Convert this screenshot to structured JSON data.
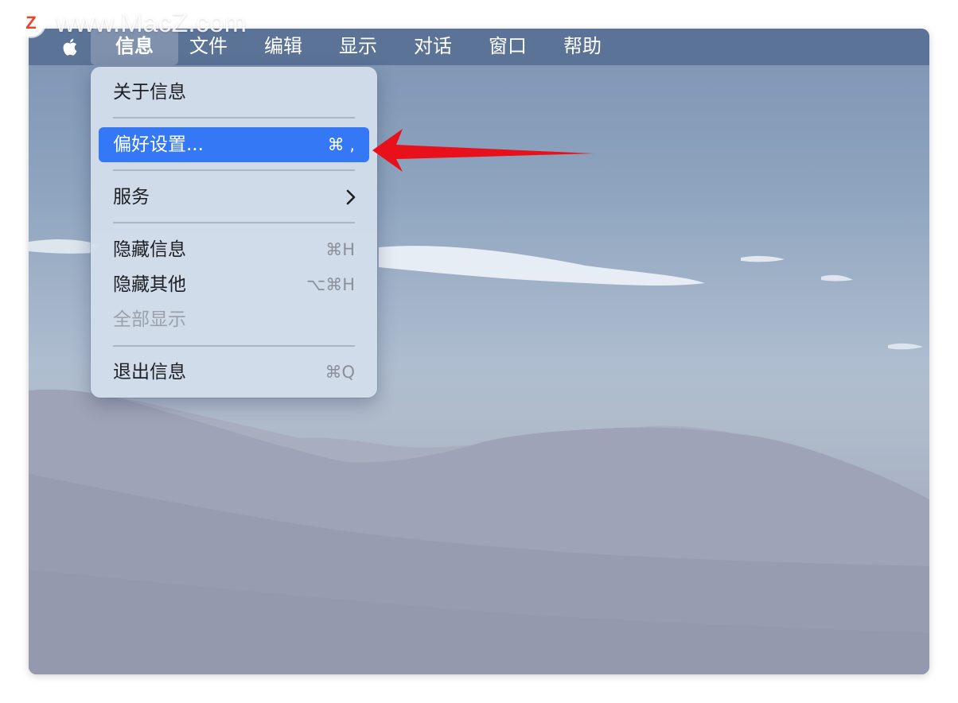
{
  "watermark": {
    "badge": "Z",
    "text": "www.MacZ.com"
  },
  "menubar": {
    "apple_icon": "apple-logo-icon",
    "items": [
      {
        "label": "信息",
        "active": true
      },
      {
        "label": "文件"
      },
      {
        "label": "编辑"
      },
      {
        "label": "显示"
      },
      {
        "label": "对话"
      },
      {
        "label": "窗口"
      },
      {
        "label": "帮助"
      }
    ]
  },
  "menu": {
    "items": [
      {
        "label": "关于信息",
        "shortcut": ""
      },
      {
        "label": "偏好设置...",
        "shortcut": "⌘ ,",
        "selected": true
      },
      {
        "label": "服务",
        "submenu_icon": "chevron-right-icon"
      },
      {
        "label": "隐藏信息",
        "shortcut": "⌘H"
      },
      {
        "label": "隐藏其他",
        "shortcut": "⌥⌘H"
      },
      {
        "label": "全部显示",
        "shortcut": "",
        "disabled": true
      },
      {
        "label": "退出信息",
        "shortcut": "⌘Q"
      }
    ]
  },
  "colors": {
    "selection": "#3478f6",
    "arrow": "#e8101a"
  }
}
